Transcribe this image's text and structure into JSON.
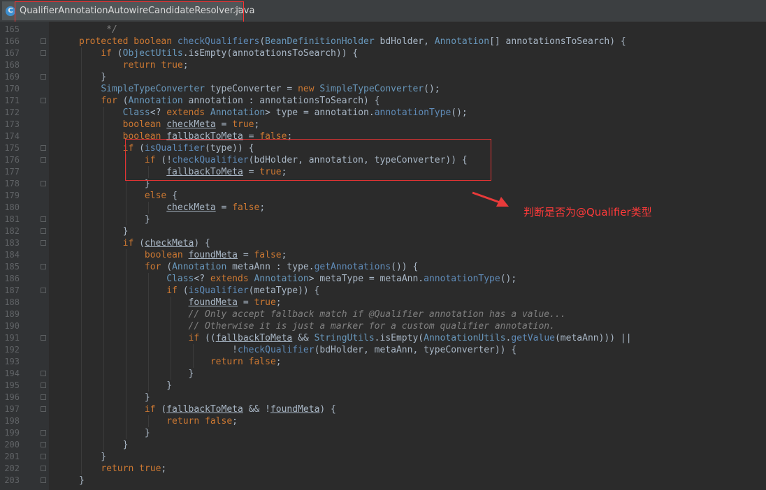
{
  "tab": {
    "icon_letter": "C",
    "filename": "QualifierAnnotationAutowireCandidateResolver.java",
    "close_glyph": "×"
  },
  "annotation": {
    "text": "判断是否为@Qualifier类型",
    "color": "#ff3a3a"
  },
  "theme": {
    "keyword": "#cc7832",
    "type": "#6897bb",
    "method_decl": "#ffc66d",
    "method_call": "#5f8bb8",
    "comment": "#808080",
    "default": "#a9b7c6",
    "background": "#2b2b2b"
  },
  "code": {
    "lines": [
      {
        "n": "165",
        "segs": [
          [
            "    ",
            ""
          ],
          [
            " */",
            "cm"
          ]
        ]
      },
      {
        "n": "166",
        "segs": [
          [
            "protected ",
            "kw"
          ],
          [
            "boolean ",
            "kw"
          ],
          [
            "checkQualifiers",
            "mt"
          ],
          [
            "(",
            ""
          ],
          [
            "BeanDefinitionHolder",
            "ty"
          ],
          [
            " bdHolder, ",
            ""
          ],
          [
            "Annotation",
            "ty"
          ],
          [
            "[] annotationsToSearch) {",
            ""
          ]
        ]
      },
      {
        "n": "167",
        "segs": [
          [
            "    ",
            ""
          ],
          [
            "if ",
            "kw"
          ],
          [
            "(",
            ""
          ],
          [
            "ObjectUtils",
            "ty"
          ],
          [
            ".isEmpty(annotationsToSearch)) {",
            ""
          ]
        ]
      },
      {
        "n": "168",
        "segs": [
          [
            "        ",
            ""
          ],
          [
            "return ",
            "kw"
          ],
          [
            "true",
            "kw"
          ],
          [
            ";",
            ""
          ]
        ]
      },
      {
        "n": "169",
        "segs": [
          [
            "    }",
            ""
          ]
        ]
      },
      {
        "n": "170",
        "segs": [
          [
            "    ",
            ""
          ],
          [
            "SimpleTypeConverter",
            "ty"
          ],
          [
            " typeConverter = ",
            ""
          ],
          [
            "new ",
            "kw"
          ],
          [
            "SimpleTypeConverter",
            "ty"
          ],
          [
            "();",
            ""
          ]
        ]
      },
      {
        "n": "171",
        "segs": [
          [
            "    ",
            ""
          ],
          [
            "for ",
            "kw"
          ],
          [
            "(",
            ""
          ],
          [
            "Annotation",
            "ty"
          ],
          [
            " annotation : annotationsToSearch) {",
            ""
          ]
        ]
      },
      {
        "n": "172",
        "segs": [
          [
            "        ",
            ""
          ],
          [
            "Class",
            "ty"
          ],
          [
            "<? ",
            ""
          ],
          [
            "extends ",
            "kw"
          ],
          [
            "Annotation",
            "ty"
          ],
          [
            "> type = annotation.",
            ""
          ],
          [
            "annotationType",
            "mt"
          ],
          [
            "();",
            ""
          ]
        ]
      },
      {
        "n": "173",
        "segs": [
          [
            "        ",
            ""
          ],
          [
            "boolean ",
            "kw"
          ],
          [
            "checkMeta",
            "ul"
          ],
          [
            " = ",
            ""
          ],
          [
            "true",
            "kw"
          ],
          [
            ";",
            ""
          ]
        ]
      },
      {
        "n": "174",
        "segs": [
          [
            "        ",
            ""
          ],
          [
            "boolean ",
            "kw"
          ],
          [
            "fallbackToMeta",
            "ul"
          ],
          [
            " = ",
            ""
          ],
          [
            "false",
            "kw"
          ],
          [
            ";",
            ""
          ]
        ]
      },
      {
        "n": "175",
        "segs": [
          [
            "        ",
            ""
          ],
          [
            "if ",
            "kw"
          ],
          [
            "(",
            ""
          ],
          [
            "isQualifier",
            "mt"
          ],
          [
            "(type)) {",
            ""
          ]
        ]
      },
      {
        "n": "176",
        "segs": [
          [
            "            ",
            ""
          ],
          [
            "if ",
            "kw"
          ],
          [
            "(!",
            ""
          ],
          [
            "checkQualifier",
            "mt"
          ],
          [
            "(bdHolder, annotation, typeConverter)) {",
            ""
          ]
        ]
      },
      {
        "n": "177",
        "segs": [
          [
            "                ",
            ""
          ],
          [
            "fallbackToMeta",
            "ul"
          ],
          [
            " = ",
            ""
          ],
          [
            "true",
            "kw"
          ],
          [
            ";",
            ""
          ]
        ]
      },
      {
        "n": "178",
        "segs": [
          [
            "            }",
            ""
          ]
        ]
      },
      {
        "n": "179",
        "segs": [
          [
            "            ",
            ""
          ],
          [
            "else ",
            "kw"
          ],
          [
            "{",
            ""
          ]
        ]
      },
      {
        "n": "180",
        "segs": [
          [
            "                ",
            ""
          ],
          [
            "checkMeta",
            "ul"
          ],
          [
            " = ",
            ""
          ],
          [
            "false",
            "kw"
          ],
          [
            ";",
            ""
          ]
        ]
      },
      {
        "n": "181",
        "segs": [
          [
            "            }",
            ""
          ]
        ]
      },
      {
        "n": "182",
        "segs": [
          [
            "        }",
            ""
          ]
        ]
      },
      {
        "n": "183",
        "segs": [
          [
            "        ",
            ""
          ],
          [
            "if ",
            "kw"
          ],
          [
            "(",
            ""
          ],
          [
            "checkMeta",
            "ul"
          ],
          [
            ") {",
            ""
          ]
        ]
      },
      {
        "n": "184",
        "segs": [
          [
            "            ",
            ""
          ],
          [
            "boolean ",
            "kw"
          ],
          [
            "foundMeta",
            "ul"
          ],
          [
            " = ",
            ""
          ],
          [
            "false",
            "kw"
          ],
          [
            ";",
            ""
          ]
        ]
      },
      {
        "n": "185",
        "segs": [
          [
            "            ",
            ""
          ],
          [
            "for ",
            "kw"
          ],
          [
            "(",
            ""
          ],
          [
            "Annotation",
            "ty"
          ],
          [
            " metaAnn : type.",
            ""
          ],
          [
            "getAnnotations",
            "mt"
          ],
          [
            "()) {",
            ""
          ]
        ]
      },
      {
        "n": "186",
        "segs": [
          [
            "                ",
            ""
          ],
          [
            "Class",
            "ty"
          ],
          [
            "<? ",
            ""
          ],
          [
            "extends ",
            "kw"
          ],
          [
            "Annotation",
            "ty"
          ],
          [
            "> metaType = metaAnn.",
            ""
          ],
          [
            "annotationType",
            "mt"
          ],
          [
            "();",
            ""
          ]
        ]
      },
      {
        "n": "187",
        "segs": [
          [
            "                ",
            ""
          ],
          [
            "if ",
            "kw"
          ],
          [
            "(",
            ""
          ],
          [
            "isQualifier",
            "mt"
          ],
          [
            "(metaType)) {",
            ""
          ]
        ]
      },
      {
        "n": "188",
        "segs": [
          [
            "                    ",
            ""
          ],
          [
            "foundMeta",
            "ul"
          ],
          [
            " = ",
            ""
          ],
          [
            "true",
            "kw"
          ],
          [
            ";",
            ""
          ]
        ]
      },
      {
        "n": "189",
        "segs": [
          [
            "                    ",
            ""
          ],
          [
            "// Only accept fallback match if @Qualifier annotation has a value...",
            "cm"
          ]
        ]
      },
      {
        "n": "190",
        "segs": [
          [
            "                    ",
            ""
          ],
          [
            "// Otherwise it is just a marker for a custom qualifier annotation.",
            "cm"
          ]
        ]
      },
      {
        "n": "191",
        "segs": [
          [
            "                    ",
            ""
          ],
          [
            "if ",
            "kw"
          ],
          [
            "((",
            ""
          ],
          [
            "fallbackToMeta",
            "ul"
          ],
          [
            " && ",
            ""
          ],
          [
            "StringUtils",
            "ty"
          ],
          [
            ".isEmpty(",
            ""
          ],
          [
            "AnnotationUtils",
            "ty"
          ],
          [
            ".",
            ""
          ],
          [
            "getValue",
            "mt"
          ],
          [
            "(metaAnn))) ||",
            ""
          ]
        ]
      },
      {
        "n": "192",
        "segs": [
          [
            "                            !",
            ""
          ],
          [
            "checkQualifier",
            "mt"
          ],
          [
            "(bdHolder, metaAnn, typeConverter)) {",
            ""
          ]
        ]
      },
      {
        "n": "193",
        "segs": [
          [
            "                        ",
            ""
          ],
          [
            "return ",
            "kw"
          ],
          [
            "false",
            "kw"
          ],
          [
            ";",
            ""
          ]
        ]
      },
      {
        "n": "194",
        "segs": [
          [
            "                    }",
            ""
          ]
        ]
      },
      {
        "n": "195",
        "segs": [
          [
            "                }",
            ""
          ]
        ]
      },
      {
        "n": "196",
        "segs": [
          [
            "            }",
            ""
          ]
        ]
      },
      {
        "n": "197",
        "segs": [
          [
            "            ",
            ""
          ],
          [
            "if ",
            "kw"
          ],
          [
            "(",
            ""
          ],
          [
            "fallbackToMeta",
            "ul"
          ],
          [
            " && !",
            ""
          ],
          [
            "foundMeta",
            "ul"
          ],
          [
            ") {",
            ""
          ]
        ]
      },
      {
        "n": "198",
        "segs": [
          [
            "                ",
            ""
          ],
          [
            "return ",
            "kw"
          ],
          [
            "false",
            "kw"
          ],
          [
            ";",
            ""
          ]
        ]
      },
      {
        "n": "199",
        "segs": [
          [
            "            }",
            ""
          ]
        ]
      },
      {
        "n": "200",
        "segs": [
          [
            "        }",
            ""
          ]
        ]
      },
      {
        "n": "201",
        "segs": [
          [
            "    }",
            ""
          ]
        ]
      },
      {
        "n": "202",
        "segs": [
          [
            "    ",
            ""
          ],
          [
            "return ",
            "kw"
          ],
          [
            "true",
            "kw"
          ],
          [
            ";",
            ""
          ]
        ]
      },
      {
        "n": "203",
        "segs": [
          [
            "}",
            ""
          ]
        ]
      }
    ]
  }
}
